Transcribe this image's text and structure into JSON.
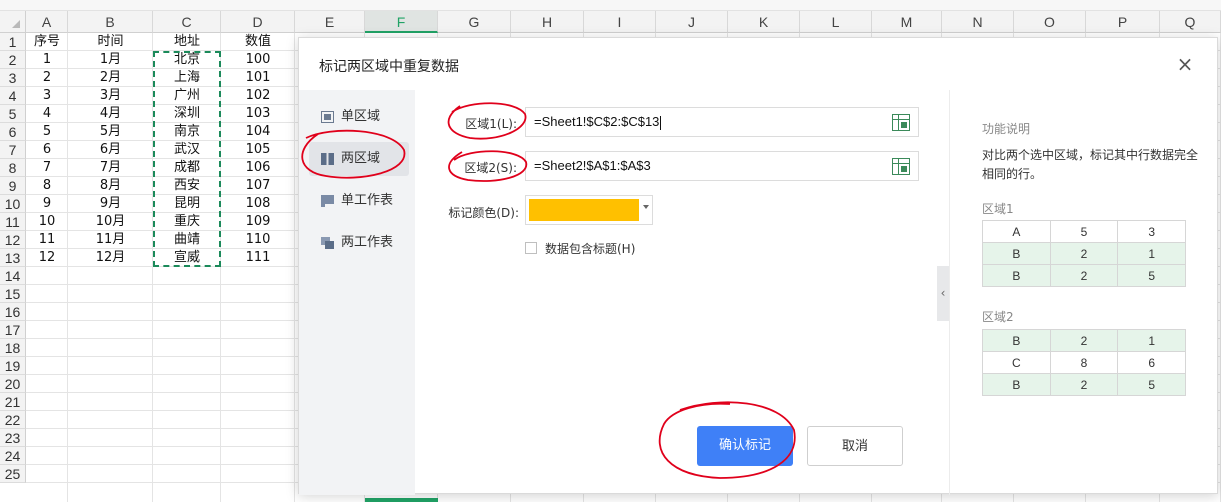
{
  "spreadsheet": {
    "columns": [
      "A",
      "B",
      "C",
      "D",
      "E",
      "F",
      "G",
      "H",
      "I",
      "J",
      "K",
      "L",
      "M",
      "N",
      "O",
      "P",
      "Q"
    ],
    "active_column": "F",
    "rows": [
      "1",
      "2",
      "3",
      "4",
      "5",
      "6",
      "7",
      "8",
      "9",
      "10",
      "11",
      "12",
      "13",
      "14",
      "15",
      "16",
      "17",
      "18",
      "19",
      "20",
      "21",
      "22",
      "23",
      "24",
      "25"
    ],
    "header": [
      "序号",
      "时间",
      "地址",
      "数值"
    ],
    "data": [
      [
        "1",
        "1月",
        "北京",
        "100"
      ],
      [
        "2",
        "2月",
        "上海",
        "101"
      ],
      [
        "3",
        "3月",
        "广州",
        "102"
      ],
      [
        "4",
        "4月",
        "深圳",
        "103"
      ],
      [
        "5",
        "5月",
        "南京",
        "104"
      ],
      [
        "6",
        "6月",
        "武汉",
        "105"
      ],
      [
        "7",
        "7月",
        "成都",
        "106"
      ],
      [
        "8",
        "8月",
        "西安",
        "107"
      ],
      [
        "9",
        "9月",
        "昆明",
        "108"
      ],
      [
        "10",
        "10月",
        "重庆",
        "109"
      ],
      [
        "11",
        "11月",
        "曲靖",
        "110"
      ],
      [
        "12",
        "12月",
        "宣威",
        "111"
      ]
    ]
  },
  "dialog": {
    "title": "标记两区域中重复数据",
    "close_glyph": "×",
    "sidebar": [
      {
        "label": "单区域",
        "icon": "single-range-icon"
      },
      {
        "label": "两区域",
        "icon": "two-range-icon"
      },
      {
        "label": "单工作表",
        "icon": "single-sheet-icon"
      },
      {
        "label": "两工作表",
        "icon": "two-sheets-icon"
      }
    ],
    "active_sidebar": "两区域",
    "range1_label": "区域1(L):",
    "range1_value": "=Sheet1!$C$2:$C$13",
    "range2_label": "区域2(S):",
    "range2_value": "=Sheet2!$A$1:$A$3",
    "color_label": "标记颜色(D):",
    "mark_color": "#ffc000",
    "header_checkbox_label": "数据包含标题(H)",
    "header_checkbox_checked": false,
    "confirm_label": "确认标记",
    "cancel_label": "取消",
    "collapse_glyph": "‹",
    "help": {
      "title": "功能说明",
      "description": "对比两个选中区域，标记其中行数据完全相同的行。",
      "example1_label": "区域1",
      "example1": [
        [
          "A",
          "5",
          "3"
        ],
        [
          "B",
          "2",
          "1"
        ],
        [
          "B",
          "2",
          "5"
        ]
      ],
      "example1_highlight": [
        false,
        true,
        true
      ],
      "example2_label": "区域2",
      "example2": [
        [
          "B",
          "2",
          "1"
        ],
        [
          "C",
          "8",
          "6"
        ],
        [
          "B",
          "2",
          "5"
        ]
      ],
      "example2_highlight": [
        true,
        false,
        true
      ]
    }
  },
  "colors": {
    "accent_green": "#21a366",
    "primary_blue": "#3f80f7",
    "annotation_red": "#e0001b",
    "match_highlight": "#e6f4ea"
  }
}
